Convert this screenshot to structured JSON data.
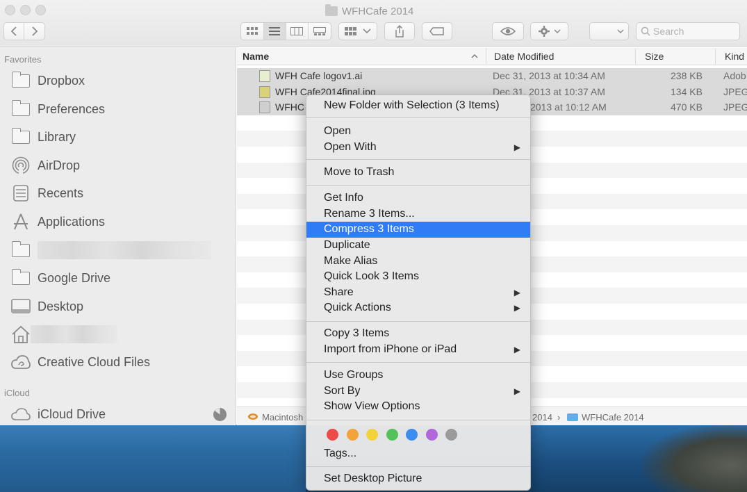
{
  "window": {
    "title": "WFHCafe 2014"
  },
  "toolbar": {
    "search_placeholder": "Search"
  },
  "sidebar": {
    "favorites_heading": "Favorites",
    "icloud_heading": "iCloud",
    "items": [
      {
        "label": "Dropbox",
        "icon": "folder-icon"
      },
      {
        "label": "Preferences",
        "icon": "folder-icon"
      },
      {
        "label": "Library",
        "icon": "folder-icon"
      },
      {
        "label": "AirDrop",
        "icon": "airdrop-icon"
      },
      {
        "label": "Recents",
        "icon": "recents-icon"
      },
      {
        "label": "Applications",
        "icon": "applications-icon"
      },
      {
        "label": "",
        "icon": "folder-icon"
      },
      {
        "label": "Google Drive",
        "icon": "folder-icon"
      },
      {
        "label": "Desktop",
        "icon": "desktop-icon"
      },
      {
        "label": "",
        "icon": "home-icon"
      },
      {
        "label": "Creative Cloud Files",
        "icon": "creative-cloud-icon"
      }
    ],
    "icloud_items": [
      {
        "label": "iCloud Drive",
        "icon": "cloud-icon"
      }
    ]
  },
  "list": {
    "columns": [
      "Name",
      "Date Modified",
      "Size",
      "Kind"
    ],
    "files": [
      {
        "name": "WFH Cafe logov1.ai",
        "date": "Dec 31, 2013 at 10:34 AM",
        "size": "238 KB",
        "kind": "Adob"
      },
      {
        "name": "WFH Cafe2014final.jpg",
        "date": "Dec 31, 2013 at 10:37 AM",
        "size": "134 KB",
        "kind": "JPEG"
      },
      {
        "name": "WFHC",
        "date": "2013 at 10:12 AM",
        "size": "470 KB",
        "kind": "JPEG"
      }
    ]
  },
  "pathbar": {
    "disk": "Macintosh",
    "parent": "2014",
    "current": "WFHCafe 2014",
    "separator": "›"
  },
  "context_menu": {
    "items": [
      "New Folder with Selection (3 Items)",
      "Open",
      "Open With",
      "Move to Trash",
      "Get Info",
      "Rename 3 Items...",
      "Compress 3 Items",
      "Duplicate",
      "Make Alias",
      "Quick Look 3 Items",
      "Share",
      "Quick Actions",
      "Copy 3 Items",
      "Import from iPhone or iPad",
      "Use Groups",
      "Sort By",
      "Show View Options",
      "Tags...",
      "Set Desktop Picture"
    ],
    "highlighted": "Compress 3 Items",
    "submenu_arrow": "▶",
    "tag_colors": [
      "#ec4b48",
      "#f4a23a",
      "#f3d33c",
      "#53c25a",
      "#3b8ef0",
      "#b168dc",
      "#9b9b9b"
    ]
  }
}
